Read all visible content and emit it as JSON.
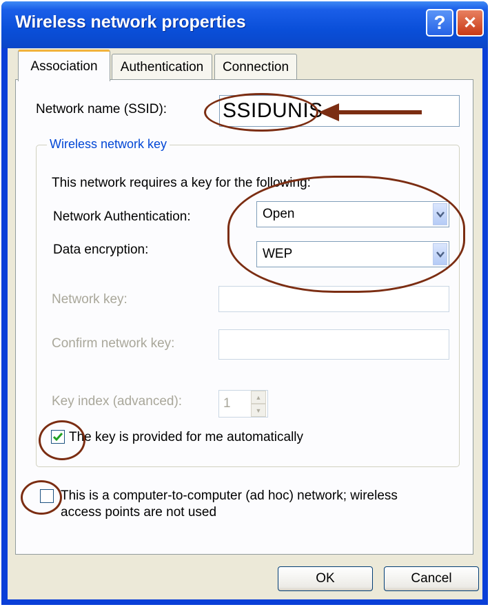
{
  "window": {
    "title": "Wireless network properties",
    "help_glyph": "?",
    "close_glyph": "✕"
  },
  "tabs": [
    {
      "label": "Association",
      "active": true
    },
    {
      "label": "Authentication",
      "active": false
    },
    {
      "label": "Connection",
      "active": false
    }
  ],
  "association": {
    "ssid_label": "Network name (SSID):",
    "ssid_value": "SSIDUNIS",
    "group_title": "Wireless network key",
    "requires_text": "This network requires a key for the following:",
    "auth_label": "Network Authentication:",
    "auth_value": "Open",
    "encryption_label": "Data encryption:",
    "encryption_value": "WEP",
    "network_key_label": "Network key:",
    "network_key_value": "",
    "confirm_key_label": "Confirm network key:",
    "confirm_key_value": "",
    "key_index_label": "Key index (advanced):",
    "key_index_value": "1",
    "auto_key_label": "The key is provided for me automatically",
    "auto_key_checked": true,
    "adhoc_label_line1": "This is a computer-to-computer (ad hoc) network; wireless",
    "adhoc_label_line2": "access points are not used",
    "adhoc_checked": false
  },
  "buttons": {
    "ok": "OK",
    "cancel": "Cancel"
  },
  "colors": {
    "titlebar": "#0a4fd9",
    "annotation": "#7b2d12",
    "group_title": "#0046d5",
    "active_tab_accent": "#f1b23b"
  },
  "icons": {
    "dropdown": "chevron-down-icon",
    "spin_up": "spin-up-icon",
    "spin_down": "spin-down-icon",
    "check": "checkmark-icon"
  }
}
